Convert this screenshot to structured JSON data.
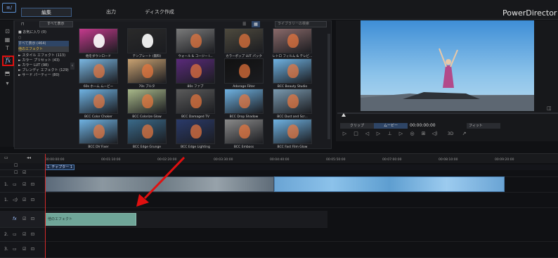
{
  "app": {
    "name": "PowerDirector",
    "logo_text": "≡/",
    "brand": "PowerDirector"
  },
  "top_tabs": [
    {
      "label": "編集"
    },
    {
      "label": "出力"
    },
    {
      "label": "ディスク作成"
    }
  ],
  "library": {
    "filter": "すべて表示",
    "search_placeholder": "ライブラリーの検索",
    "tree": [
      {
        "label": "■ お気に入り (0)"
      },
      {
        "label": "すべて表示 (464)"
      },
      {
        "label": "他のエフェクト"
      },
      {
        "label": "► スタイル エフェクト (113)"
      },
      {
        "label": "► カラー プリセット (43)"
      },
      {
        "label": "► カラー LUT (98)"
      },
      {
        "label": "► ブレンディ エフェクト (129)"
      },
      {
        "label": "► サード パーティー (80)"
      }
    ],
    "effects": [
      {
        "label": "他をダウンロード",
        "color": "#c53a8d"
      },
      {
        "label": "テンプレート (無料)",
        "color": "#2a2a2a"
      },
      {
        "label": "ウォール & コージー I...",
        "color": "#7a7a7a"
      },
      {
        "label": "カラーポップ LUT パック",
        "color": "#4e4a3e"
      },
      {
        "label": "レトロ フィルム & テレビ...",
        "color": "#8a6a6a"
      },
      {
        "label": "60s ホーム ムービー",
        "color": "#7ab7e2"
      },
      {
        "label": "70s ブルタ",
        "color": "#c9a272"
      },
      {
        "label": "80s ファブ",
        "color": "#5a2a7a"
      },
      {
        "label": "Adorage Filter",
        "color": "#111111"
      },
      {
        "label": "BCC Beauty Studio",
        "color": "#6fb3e3"
      },
      {
        "label": "BCC Color Choker",
        "color": "#6fb3e3"
      },
      {
        "label": "BCC Colorize Glow",
        "color": "#a9b98a"
      },
      {
        "label": "BCC Damaged TV",
        "color": "#5b5b5b"
      },
      {
        "label": "BCC Drop Shadow",
        "color": "#6fb3e3"
      },
      {
        "label": "BCC Dust and Scr...",
        "color": "#7a9ab0"
      },
      {
        "label": "BCC DV Fixer",
        "color": "#6fb3e3"
      },
      {
        "label": "BCC Edge Grunge",
        "color": "#3a6a8a"
      },
      {
        "label": "BCC Edge Lighting",
        "color": "#2a3a6a"
      },
      {
        "label": "BCC Emboss",
        "color": "#8a8a8a"
      },
      {
        "label": "BCC Fast Film Glow",
        "color": "#6fb3e3"
      }
    ]
  },
  "preview": {
    "clip_label": "クリップ",
    "movie_label": "ムービー",
    "timecode": "00:00:00:00",
    "fit_label": "フィット",
    "threed_label": "3D"
  },
  "timeline": {
    "ruler": [
      "00:00:00:00",
      "00:01:10:00",
      "00:02:20:00",
      "00:03:30:00",
      "00:04:40:00",
      "00:05:50:00",
      "00:07:00:00",
      "00:08:10:00",
      "00:09:20:00"
    ],
    "chapter": "1. チャプター 1",
    "fx_clip": "他のエフェクト",
    "track_labels": [
      "1.",
      "2.",
      "3."
    ]
  },
  "annotation": {
    "highlight_color": "#e01010",
    "arrow_color": "#e01010"
  }
}
